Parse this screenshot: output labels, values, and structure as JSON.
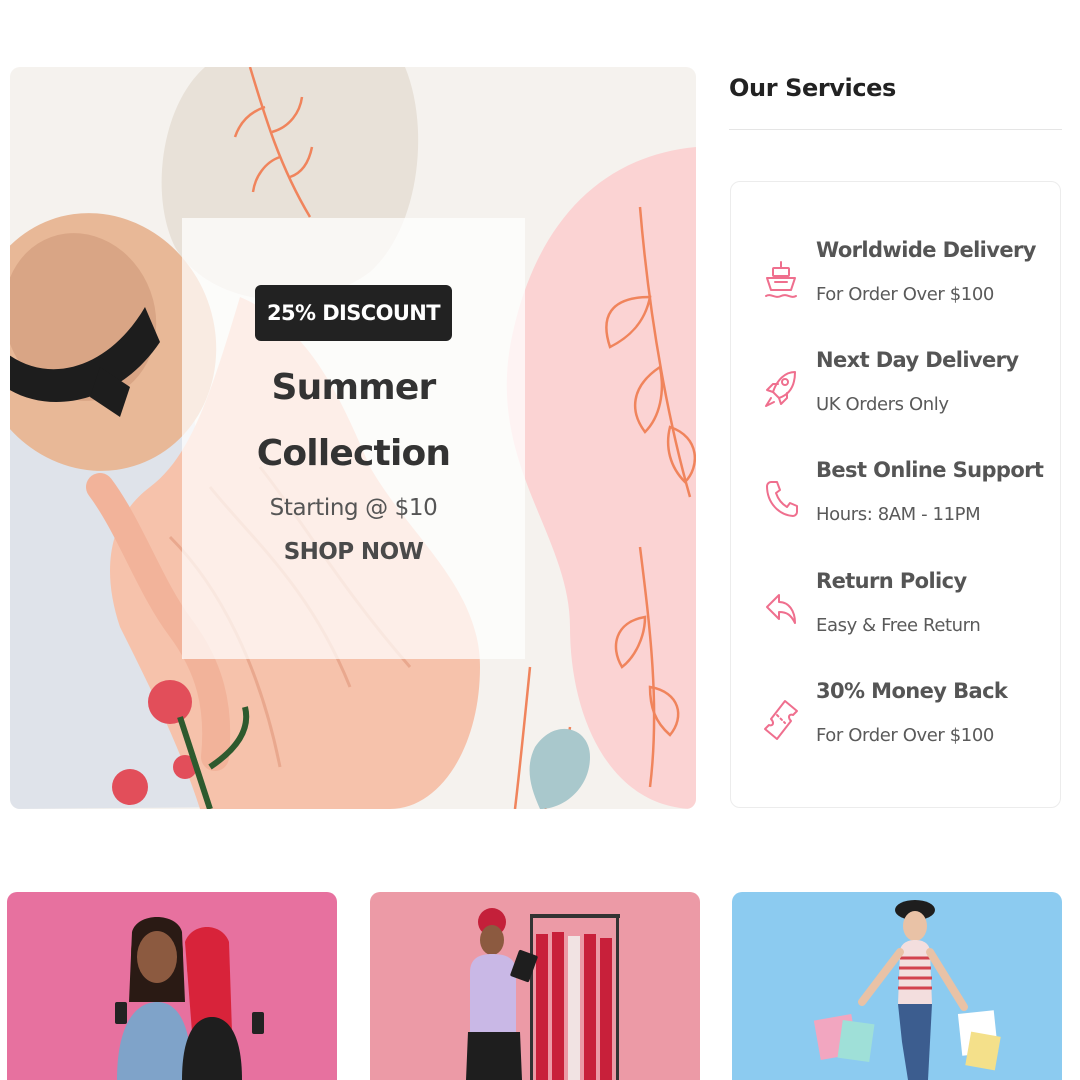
{
  "hero": {
    "badge": "25% DISCOUNT",
    "title_line1": "Summer",
    "title_line2": "Collection",
    "subtitle": "Starting @ $10",
    "cta": "SHOP NOW"
  },
  "services": {
    "heading": "Our Services",
    "items": [
      {
        "title": "Worldwide Delivery",
        "subtitle": "For Order Over $100",
        "icon": "ship-icon"
      },
      {
        "title": "Next Day Delivery",
        "subtitle": "UK Orders Only",
        "icon": "rocket-icon"
      },
      {
        "title": "Best Online Support",
        "subtitle": "Hours: 8AM - 11PM",
        "icon": "phone-icon"
      },
      {
        "title": "Return Policy",
        "subtitle": "Easy & Free Return",
        "icon": "return-arrow-icon"
      },
      {
        "title": "30% Money Back",
        "subtitle": "For Order Over $100",
        "icon": "ticket-icon"
      }
    ]
  },
  "categories": [
    {
      "background": "#e7719f"
    },
    {
      "background": "#ec9aa6"
    },
    {
      "background": "#8ccbf0"
    }
  ],
  "colors": {
    "accent": "#ef6f8e",
    "badge_bg": "#222222",
    "hero_pink": "#fbd3d3",
    "leaf_orange": "#f0845c"
  }
}
